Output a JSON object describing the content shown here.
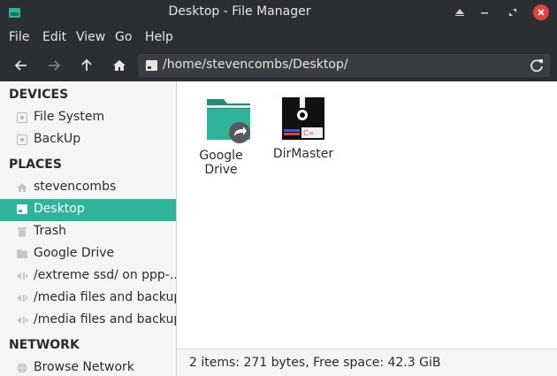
{
  "window": {
    "title": "Desktop - File Manager"
  },
  "menubar": {
    "items": [
      "File",
      "Edit",
      "View",
      "Go",
      "Help"
    ]
  },
  "toolbar": {
    "path": "/home/stevencombs/Desktop/"
  },
  "sidebar": {
    "sections": [
      {
        "label": "DEVICES",
        "items": [
          {
            "label": "File System",
            "icon": "drive-icon"
          },
          {
            "label": "BackUp",
            "icon": "drive-icon"
          }
        ]
      },
      {
        "label": "PLACES",
        "items": [
          {
            "label": "stevencombs",
            "icon": "home-icon"
          },
          {
            "label": "Desktop",
            "icon": "desktop-icon",
            "active": true
          },
          {
            "label": "Trash",
            "icon": "trash-icon"
          },
          {
            "label": "Google Drive",
            "icon": "folder-icon"
          },
          {
            "label": "/extreme ssd/ on ppp-...",
            "icon": "network-share-icon"
          },
          {
            "label": "/media files and backup...",
            "icon": "network-share-icon"
          },
          {
            "label": "/media files and backup...",
            "icon": "network-share-icon"
          }
        ]
      },
      {
        "label": "NETWORK",
        "items": [
          {
            "label": "Browse Network",
            "icon": "globe-icon"
          }
        ]
      }
    ]
  },
  "files": [
    {
      "label": "Google Drive",
      "icon": "folder-link-icon"
    },
    {
      "label": "DirMaster",
      "icon": "floppy-disk-icon"
    }
  ],
  "status": {
    "text": "2 items: 271 bytes, Free space: 42.3 GiB"
  },
  "colors": {
    "accent": "#2fb39b",
    "titlebar": "#2b2e33",
    "close": "#e0443e"
  }
}
